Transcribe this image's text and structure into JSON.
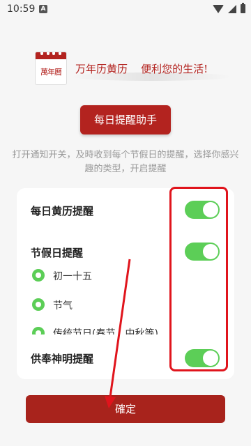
{
  "status_bar": {
    "time": "10:59",
    "badge": "A"
  },
  "header": {
    "logo_text": "萬年曆",
    "slogan": "万年历黄历    便利您的生活!"
  },
  "assistant_button": {
    "label": "每日提醒助手"
  },
  "description": "打开通知开关，及時收到每个节假日的提醒，选择你感兴趣的类型，开启提醒",
  "settings": {
    "daily_almanac": {
      "label": "每日黄历提醒",
      "enabled": true
    },
    "holiday": {
      "label": "节假日提醒",
      "enabled": true,
      "options": [
        {
          "label": "初一十五",
          "selected": true
        },
        {
          "label": "节气",
          "selected": true
        },
        {
          "label": "传统节日(春节、中秋等)",
          "selected": true
        }
      ]
    },
    "worship": {
      "label": "供奉神明提醒",
      "enabled": true
    }
  },
  "confirm_button": {
    "label": "確定"
  },
  "colors": {
    "brand_red": "#b3231f",
    "toggle_green": "#5cce57",
    "annotation_red": "#e0141c"
  }
}
